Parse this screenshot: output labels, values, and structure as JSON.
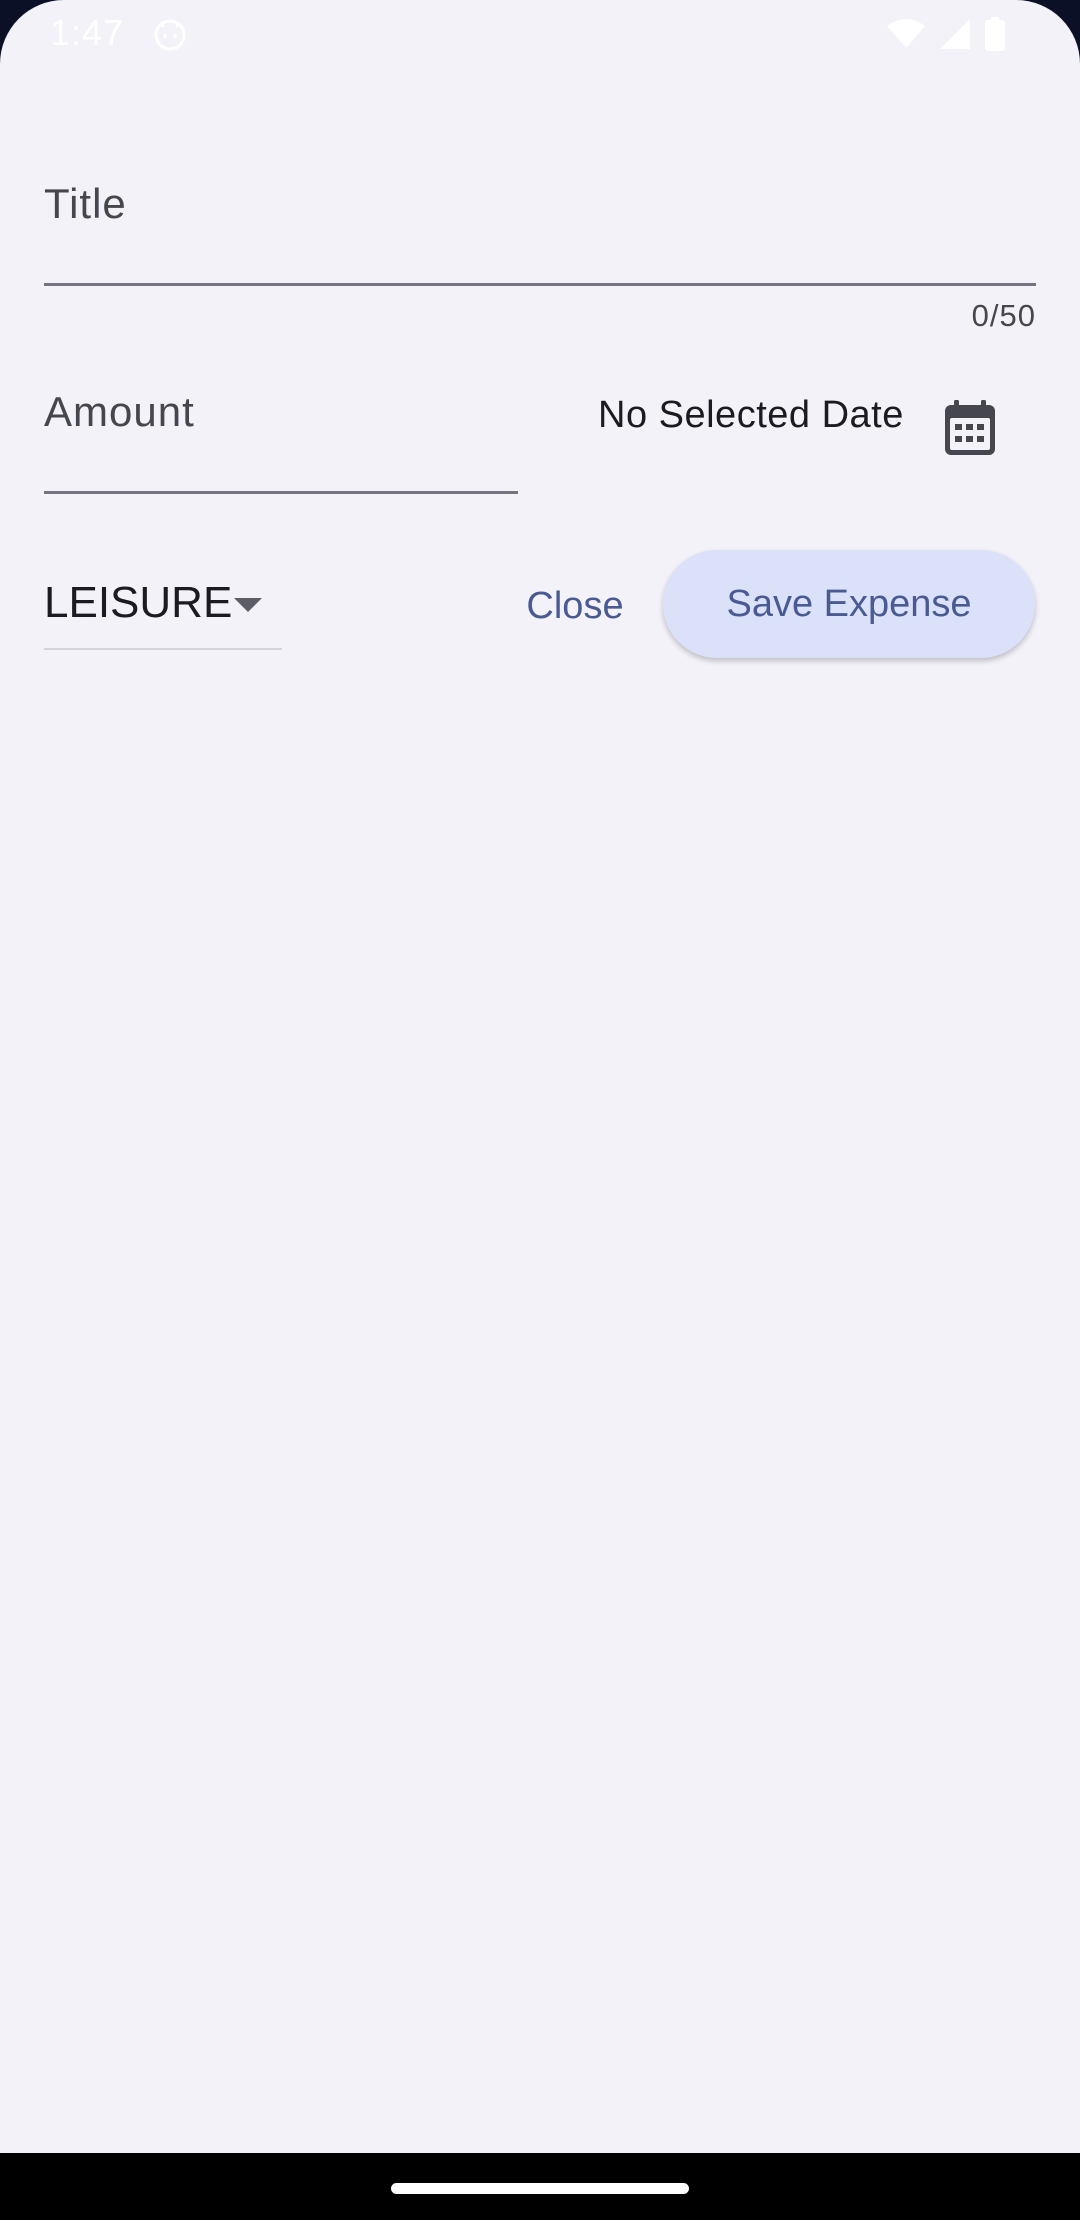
{
  "status_bar": {
    "time": "1:47",
    "app_icon": "android-head-icon",
    "icons": [
      "wifi-icon",
      "signal-icon",
      "battery-icon"
    ]
  },
  "form": {
    "title": {
      "placeholder": "Title",
      "counter": "0/50"
    },
    "amount": {
      "placeholder": "Amount"
    },
    "date": {
      "label": "No Selected Date",
      "icon": "calendar-icon"
    },
    "category": {
      "selected": "LEISURE",
      "icon": "dropdown-arrow-icon"
    },
    "actions": {
      "close_label": "Close",
      "save_label": "Save Expense"
    }
  },
  "colors": {
    "background": "#f3f2f9",
    "accent_text": "#4a5b93",
    "save_button_bg": "#dce1fa",
    "field_underline": "#76757f"
  }
}
